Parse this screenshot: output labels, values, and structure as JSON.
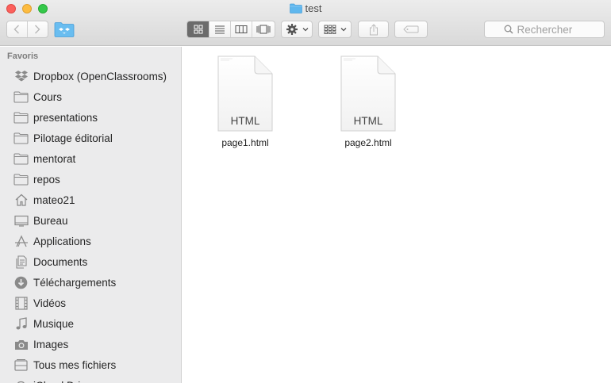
{
  "window": {
    "title": "test"
  },
  "toolbar": {
    "search_placeholder": "Rechercher"
  },
  "sidebar": {
    "heading": "Favoris",
    "items": [
      {
        "label": "Dropbox (OpenClassrooms)",
        "icon": "dropbox-icon"
      },
      {
        "label": "Cours",
        "icon": "folder-icon"
      },
      {
        "label": "presentations",
        "icon": "folder-icon"
      },
      {
        "label": "Pilotage éditorial",
        "icon": "folder-icon"
      },
      {
        "label": "mentorat",
        "icon": "folder-icon"
      },
      {
        "label": "repos",
        "icon": "folder-icon"
      },
      {
        "label": "mateo21",
        "icon": "home-icon"
      },
      {
        "label": "Bureau",
        "icon": "desktop-icon"
      },
      {
        "label": "Applications",
        "icon": "applications-icon"
      },
      {
        "label": "Documents",
        "icon": "documents-icon"
      },
      {
        "label": "Téléchargements",
        "icon": "downloads-icon"
      },
      {
        "label": "Vidéos",
        "icon": "movies-icon"
      },
      {
        "label": "Musique",
        "icon": "music-icon"
      },
      {
        "label": "Images",
        "icon": "camera-icon"
      },
      {
        "label": "Tous mes fichiers",
        "icon": "all-files-icon"
      },
      {
        "label": "iCloud Drive",
        "icon": "icloud-icon"
      }
    ]
  },
  "files": [
    {
      "name": "page1.html",
      "badge": "HTML"
    },
    {
      "name": "page2.html",
      "badge": "HTML"
    }
  ],
  "colors": {
    "folder_blue": "#5fb7ee",
    "icon_gray": "#8a8a8a"
  }
}
